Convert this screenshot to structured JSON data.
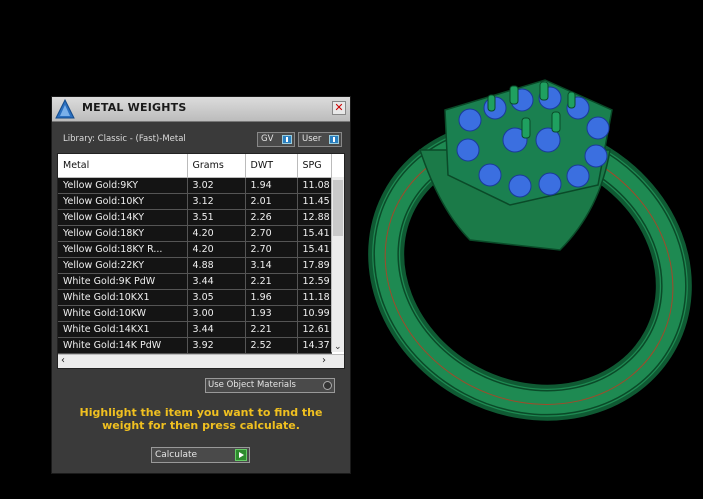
{
  "panel": {
    "title": "METAL WEIGHTS",
    "library_label": "Library: Classic - (Fast)-Metal",
    "gv_label": "GV",
    "user_label": "User",
    "table": {
      "headers": [
        "Metal",
        "Grams",
        "DWT",
        "SPG"
      ],
      "rows": [
        [
          "Yellow Gold:9KY",
          "3.02",
          "1.94",
          "11.08"
        ],
        [
          "Yellow Gold:10KY",
          "3.12",
          "2.01",
          "11.45"
        ],
        [
          "Yellow Gold:14KY",
          "3.51",
          "2.26",
          "12.88"
        ],
        [
          "Yellow Gold:18KY",
          "4.20",
          "2.70",
          "15.41"
        ],
        [
          "Yellow Gold:18KY R...",
          "4.20",
          "2.70",
          "15.41"
        ],
        [
          "Yellow Gold:22KY",
          "4.88",
          "3.14",
          "17.89"
        ],
        [
          "White Gold:9K PdW",
          "3.44",
          "2.21",
          "12.59"
        ],
        [
          "White Gold:10KX1",
          "3.05",
          "1.96",
          "11.18"
        ],
        [
          "White Gold:10KW",
          "3.00",
          "1.93",
          "10.99"
        ],
        [
          "White Gold:14KX1",
          "3.44",
          "2.21",
          "12.61"
        ],
        [
          "White Gold:14K PdW",
          "3.92",
          "2.52",
          "14.37"
        ]
      ]
    },
    "use_object_materials_label": "Use Object Materials",
    "hint_text": "Highlight the item you want to find the weight for then press calculate.",
    "calculate_label": "Calculate"
  },
  "colors": {
    "ring_green": "#1e7a4a",
    "gem_blue": "#3b6fe0",
    "hint_yellow": "#f0c020",
    "background": "#000000"
  }
}
